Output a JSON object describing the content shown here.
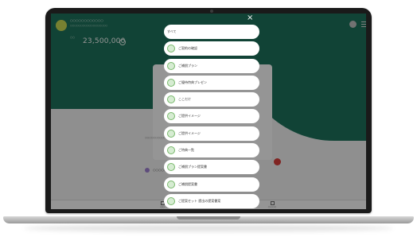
{
  "header": {
    "app_title": "○○○○○○○○○○○○",
    "app_sub": "○○○○○○○○○○○○○○○○○○",
    "amount_label": "○○",
    "amount": "23,500,000"
  },
  "content": {
    "side_text": "○○○○○○○○○○○○○○○○○○○○○○○○○○○○○○○○○○○○○○○○○○",
    "row_label": "○○○○○"
  },
  "bottom_nav": [
    {
      "label": "○○"
    },
    {
      "label": "○○"
    },
    {
      "label": "○○"
    },
    {
      "label": "○○○○"
    }
  ],
  "overlay_menu": {
    "close_label": "×",
    "items": [
      {
        "label": "すべて",
        "icon": "none"
      },
      {
        "label": "ご契約の確認",
        "icon": "check-icon"
      },
      {
        "label": "ご補償プラン",
        "icon": "plan-icon"
      },
      {
        "label": "ご優待特典プレゼン",
        "icon": "gift-icon"
      },
      {
        "label": "ここだけ",
        "icon": "star-icon"
      },
      {
        "label": "ご提供イメージ",
        "icon": "image-icon"
      },
      {
        "label": "ご提供イメージ",
        "icon": "image-icon"
      },
      {
        "label": "ご特典一覧",
        "icon": "list-icon"
      },
      {
        "label": "ご補償プラン提案書",
        "icon": "doc-icon"
      },
      {
        "label": "ご補償提案書",
        "icon": "doc-icon"
      },
      {
        "label": "ご提案セット  提出の提案書案",
        "icon": "doc-icon"
      }
    ]
  }
}
